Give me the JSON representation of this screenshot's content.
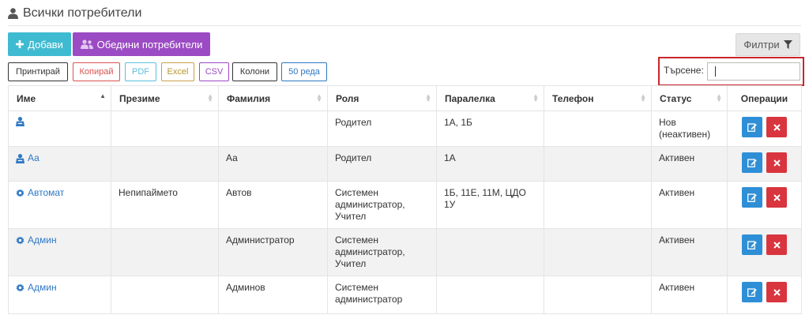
{
  "page": {
    "title": "Всички потребители"
  },
  "toolbar": {
    "add_label": "Добави",
    "merge_label": "Обедини потребители",
    "filter_label": "Филтри"
  },
  "exports": [
    {
      "label": "Принтирай",
      "color": "#333333"
    },
    {
      "label": "Копирай",
      "color": "#d9534f"
    },
    {
      "label": "PDF",
      "color": "#5bc0de"
    },
    {
      "label": "Excel",
      "color": "#c9a04a"
    },
    {
      "label": "CSV",
      "color": "#9b4bc3"
    },
    {
      "label": "Колони",
      "color": "#333333"
    },
    {
      "label": "50 реда",
      "color": "#2f78c4"
    }
  ],
  "search": {
    "label": "Търсене:",
    "value": ""
  },
  "table": {
    "columns": [
      "Име",
      "Презиме",
      "Фамилия",
      "Роля",
      "Паралелка",
      "Телефон",
      "Статус",
      "Операции"
    ],
    "rows": [
      {
        "icon": "parent-icon",
        "name": "",
        "middle": "",
        "last": "",
        "role": "Родител",
        "class": "1А, 1Б",
        "phone": "",
        "status": "Нов (неактивен)"
      },
      {
        "icon": "parent-icon",
        "name": "Аа",
        "middle": "",
        "last": "Аа",
        "role": "Родител",
        "class": "1А",
        "phone": "",
        "status": "Активен"
      },
      {
        "icon": "gear-icon",
        "name": "Автомат",
        "middle": "Непипаймето",
        "last": "Автов",
        "role": "Системен администратор, Учител",
        "class": "1Б, 11Е, 11М, ЦДО 1У",
        "phone": "",
        "status": "Активен"
      },
      {
        "icon": "gear-icon",
        "name": "Админ",
        "middle": "",
        "last": "Администратор",
        "role": "Системен администратор, Учител",
        "class": "",
        "phone": "",
        "status": "Активен"
      },
      {
        "icon": "gear-icon",
        "name": "Админ",
        "middle": "",
        "last": "Админов",
        "role": "Системен администратор",
        "class": "",
        "phone": "",
        "status": "Активен"
      }
    ]
  },
  "colors": {
    "add": "#3fbbd1",
    "merge": "#9b4bc3",
    "edit": "#2f8fd6",
    "delete": "#d9353e",
    "link": "#2f78c4",
    "highlight": "#c9262c"
  }
}
